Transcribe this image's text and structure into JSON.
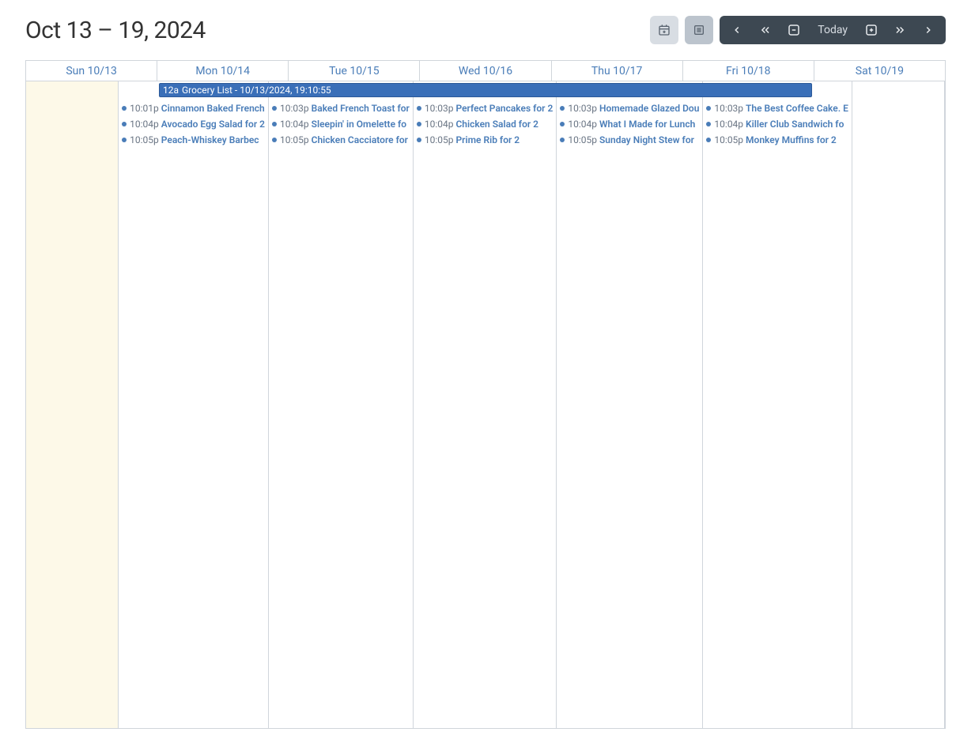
{
  "header": {
    "title": "Oct 13 – 19, 2024",
    "today_label": "Today"
  },
  "days": [
    {
      "label": "Sun 10/13",
      "sunday": true,
      "events": []
    },
    {
      "label": "Mon 10/14",
      "events": [
        {
          "time": "10:01p",
          "title": "Cinnamon Baked French"
        },
        {
          "time": "10:04p",
          "title": "Avocado Egg Salad for 2"
        },
        {
          "time": "10:05p",
          "title": "Peach-Whiskey Barbec"
        }
      ]
    },
    {
      "label": "Tue 10/15",
      "events": [
        {
          "time": "10:03p",
          "title": "Baked French Toast for"
        },
        {
          "time": "10:04p",
          "title": "Sleepin' in Omelette fo"
        },
        {
          "time": "10:05p",
          "title": "Chicken Cacciatore for"
        }
      ]
    },
    {
      "label": "Wed 10/16",
      "events": [
        {
          "time": "10:03p",
          "title": "Perfect Pancakes for 2"
        },
        {
          "time": "10:04p",
          "title": "Chicken Salad for 2"
        },
        {
          "time": "10:05p",
          "title": "Prime Rib for 2"
        }
      ]
    },
    {
      "label": "Thu 10/17",
      "events": [
        {
          "time": "10:03p",
          "title": "Homemade Glazed Dou"
        },
        {
          "time": "10:04p",
          "title": "What I Made for Lunch"
        },
        {
          "time": "10:05p",
          "title": "Sunday Night Stew for"
        }
      ]
    },
    {
      "label": "Fri 10/18",
      "events": [
        {
          "time": "10:03p",
          "title": "The Best Coffee Cake. E"
        },
        {
          "time": "10:04p",
          "title": "Killer Club Sandwich fo"
        },
        {
          "time": "10:05p",
          "title": "Monkey Muffins for 2"
        }
      ]
    },
    {
      "label": "Sat 10/19",
      "events": []
    }
  ],
  "all_day": {
    "time": "12a",
    "title": "Grocery List - 10/13/2024, 19:10:55"
  }
}
